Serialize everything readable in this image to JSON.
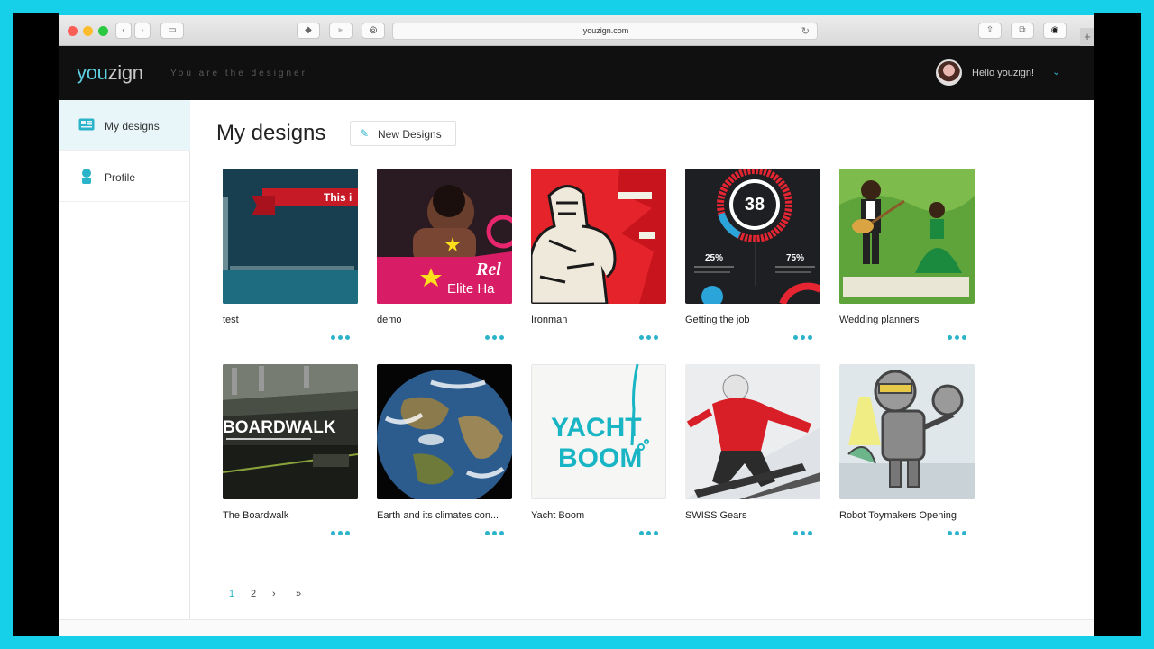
{
  "browser": {
    "url": "youzign.com",
    "buttons": {
      "back": "‹",
      "forward": "›",
      "sidebar": "▭",
      "share": "⇪",
      "tabs": "⧉",
      "downloads": "◉",
      "new_tab": "+"
    }
  },
  "header": {
    "logo_you": "you",
    "logo_zign": "zign",
    "tagline": "You are the designer",
    "greeting": "Hello youzign!",
    "menu_icon": "chevron-down-icon"
  },
  "sidebar": {
    "items": [
      {
        "label": "My designs",
        "icon": "designs-icon",
        "active": true
      },
      {
        "label": "Profile",
        "icon": "user-icon",
        "active": false
      }
    ]
  },
  "main": {
    "title": "My designs",
    "new_button": "New Designs",
    "designs": [
      {
        "title": "test",
        "thumb_text": "This i"
      },
      {
        "title": "demo",
        "thumb_text": "Rel",
        "thumb_text2": "Elite Ha"
      },
      {
        "title": "Ironman"
      },
      {
        "title": "Getting the job",
        "thumb_text": "38",
        "thumb_text2": "25%",
        "thumb_text3": "75%"
      },
      {
        "title": "Wedding planners"
      },
      {
        "title": "The Boardwalk",
        "thumb_text": "BOARDWALK"
      },
      {
        "title": "Earth and its climates con..."
      },
      {
        "title": "Yacht Boom",
        "thumb_text": "YACHT",
        "thumb_text2": "BOOM"
      },
      {
        "title": "SWISS Gears"
      },
      {
        "title": "Robot Toymakers Opening"
      }
    ],
    "more_icon": "more-dots-icon"
  },
  "pagination": {
    "pages": [
      "1",
      "2"
    ],
    "current": "1",
    "next": "›",
    "last": "»"
  },
  "colors": {
    "accent": "#2bb3c9",
    "header_bg": "#101010",
    "frame": "#16d0ea"
  }
}
